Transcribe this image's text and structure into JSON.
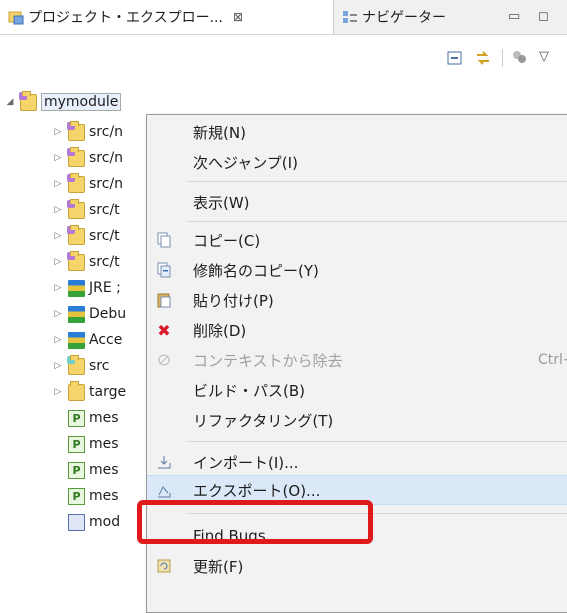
{
  "tabs": [
    {
      "label": "プロジェクト・エクスプロー...",
      "close": "⊠",
      "icon": "project-explorer-icon"
    },
    {
      "label": "ナビゲーター",
      "icon": "navigator-icon"
    }
  ],
  "window_buttons": {
    "minimize": "▭",
    "maximize": "◻"
  },
  "toolbar": {
    "icons": [
      "collapse-all-icon",
      "link-with-editor-icon",
      "filter-icon",
      "view-menu-icon"
    ],
    "view_menu": "▽"
  },
  "tree": {
    "root": "mymodule",
    "items": [
      {
        "label": "src/n",
        "icon": "source-folder-icon"
      },
      {
        "label": "src/n",
        "icon": "source-folder-icon"
      },
      {
        "label": "src/n",
        "icon": "source-folder-icon"
      },
      {
        "label": "src/t",
        "icon": "source-folder-icon"
      },
      {
        "label": "src/t",
        "icon": "source-folder-icon"
      },
      {
        "label": "src/t",
        "icon": "source-folder-icon"
      },
      {
        "label": "JRE ;",
        "icon": "library-icon"
      },
      {
        "label": "Debu",
        "icon": "library-icon"
      },
      {
        "label": "Acce",
        "icon": "library-icon"
      },
      {
        "label": "src",
        "icon": "folder-icon"
      },
      {
        "label": "targe",
        "icon": "folder-icon"
      },
      {
        "label": "mes",
        "icon": "properties-file-icon"
      },
      {
        "label": "mes",
        "icon": "properties-file-icon"
      },
      {
        "label": "mes",
        "icon": "properties-file-icon"
      },
      {
        "label": "mes",
        "icon": "properties-file-icon"
      },
      {
        "label": "mod",
        "icon": "module-file-icon"
      }
    ]
  },
  "context_menu": {
    "items": [
      {
        "label": "新規(N)"
      },
      {
        "label": "次へジャンプ(I)"
      },
      {
        "label": "表示(W)"
      },
      {
        "label": "コピー(C)",
        "icon": "copy-icon"
      },
      {
        "label": "修飾名のコピー(Y)",
        "icon": "copy-qualified-name-icon"
      },
      {
        "label": "貼り付け(P)",
        "icon": "paste-icon"
      },
      {
        "label": "削除(D)",
        "icon": "delete-icon",
        "glyph": "✖"
      },
      {
        "label": "コンテキストから除去",
        "accel": "Ctrl+.",
        "icon": "remove-from-context-icon",
        "disabled": true
      },
      {
        "label": "ビルド・パス(B)"
      },
      {
        "label": "リファクタリング(T)"
      },
      {
        "label": "インポート(I)...",
        "icon": "import-icon"
      },
      {
        "label": "エクスポート(O)...",
        "icon": "export-icon",
        "highlighted": true
      },
      {
        "label": "Find Bugs"
      },
      {
        "label": "更新(F)",
        "icon": "refresh-icon"
      }
    ]
  },
  "colors": {
    "highlight_box": "#e0191a",
    "menu_hover": "#dbe8f8"
  }
}
